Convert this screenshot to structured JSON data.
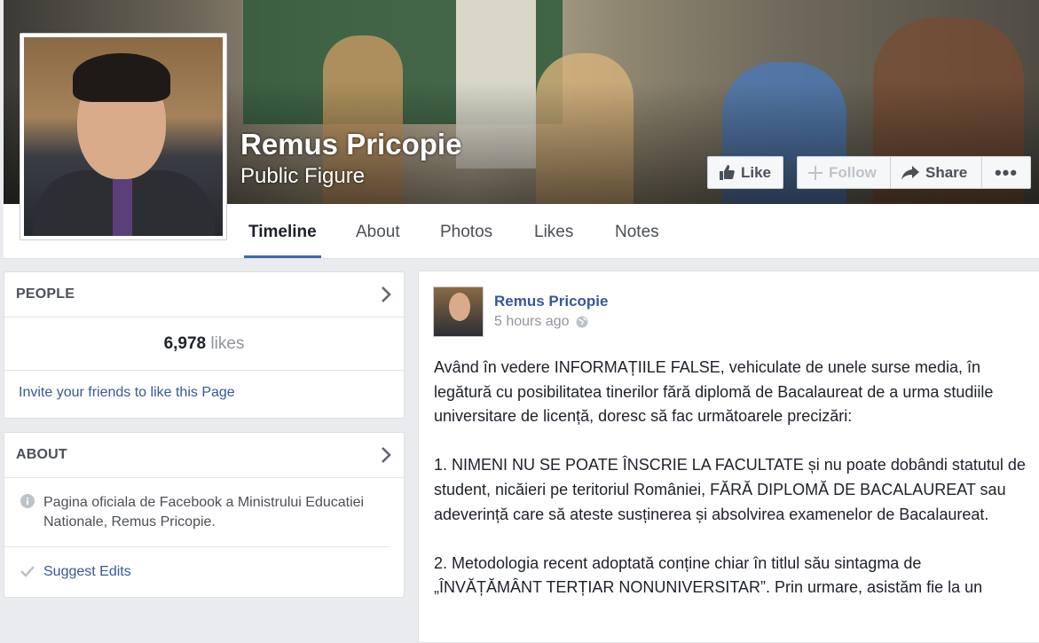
{
  "page": {
    "name": "Remus Pricopie",
    "category": "Public Figure"
  },
  "actions": {
    "like": "Like",
    "follow": "Follow",
    "share": "Share",
    "more": "•••"
  },
  "tabs": [
    "Timeline",
    "About",
    "Photos",
    "Likes",
    "Notes"
  ],
  "people": {
    "title": "PEOPLE",
    "likes_count": "6,978",
    "likes_unit": "likes",
    "invite": "Invite your friends to like this Page"
  },
  "about": {
    "title": "ABOUT",
    "description": "Pagina oficiala de Facebook a Ministrului Educatiei Nationale, Remus Pricopie.",
    "suggest": "Suggest Edits"
  },
  "post": {
    "author": "Remus Pricopie",
    "time": "5 hours ago",
    "paragraphs": [
      "Având în vedere INFORMAȚIILE FALSE, vehiculate de unele surse media, în legătură cu posibilitatea tinerilor fără diplomă de Bacalaureat de a urma studiile universitare de licență, doresc să fac următoarele precizări:",
      "1. NIMENI NU SE POATE ÎNSCRIE LA FACULTATE și nu poate dobândi statutul de student, nicăieri pe teritoriul României, FĂRĂ DIPLOMĂ DE BACALAUREAT sau adeverință care să ateste susținerea și absolvirea examenelor de Bacalaureat.",
      "2. Metodologia recent adoptată conține chiar în titlul său sintagma de „ÎNVĂȚĂMÂNT TERȚIAR NONUNIVERSITAR”. Prin urmare, asistăm fie la un"
    ]
  },
  "colors": {
    "link": "#365899",
    "tab_active": "#4267b2",
    "background": "#e9ebee"
  }
}
